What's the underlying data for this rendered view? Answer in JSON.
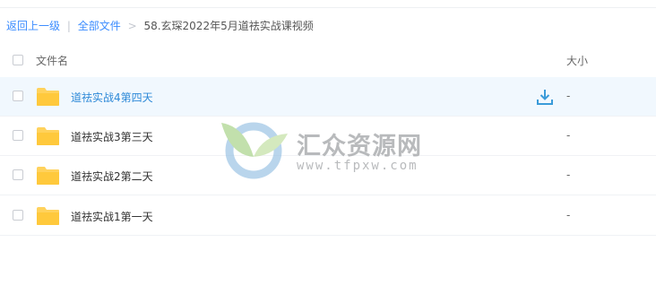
{
  "breadcrumb": {
    "back": "返回上一级",
    "all_files": "全部文件",
    "separator": "|",
    "arrow": ">",
    "current": "58.玄琛2022年5月道祛实战课视频"
  },
  "header": {
    "name_col": "文件名",
    "size_col": "大小"
  },
  "files": [
    {
      "name": "道祛实战4第四天",
      "size": "-",
      "selected": true
    },
    {
      "name": "道祛实战3第三天",
      "size": "-",
      "selected": false
    },
    {
      "name": "道祛实战2第二天",
      "size": "-",
      "selected": false
    },
    {
      "name": "道祛实战1第一天",
      "size": "-",
      "selected": false
    }
  ],
  "watermark": {
    "title": "汇众资源网",
    "url": "www.tfpxw.com"
  },
  "icons": {
    "folder": "folder-icon",
    "download": "download-icon"
  },
  "colors": {
    "link": "#3b8cff",
    "selected_bg": "#f1f8fe",
    "folder": "#ffd25c",
    "download": "#3a9bd9"
  }
}
